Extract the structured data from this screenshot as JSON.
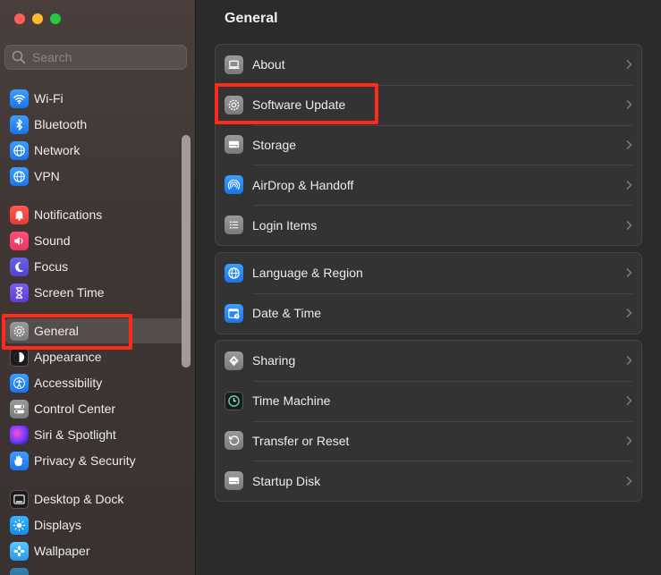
{
  "sidebar": {
    "search_placeholder": "Search",
    "items": [
      {
        "label": "Wi-Fi",
        "icon": "wifi-icon"
      },
      {
        "label": "Bluetooth",
        "icon": "bluetooth-icon"
      },
      {
        "label": "Network",
        "icon": "globe-icon"
      },
      {
        "label": "VPN",
        "icon": "globe-icon"
      },
      {
        "label": "Notifications",
        "icon": "bell-icon"
      },
      {
        "label": "Sound",
        "icon": "speaker-icon"
      },
      {
        "label": "Focus",
        "icon": "moon-icon"
      },
      {
        "label": "Screen Time",
        "icon": "hourglass-icon"
      },
      {
        "label": "General",
        "icon": "gear-icon",
        "selected": true
      },
      {
        "label": "Appearance",
        "icon": "appearance-icon"
      },
      {
        "label": "Accessibility",
        "icon": "accessibility-icon"
      },
      {
        "label": "Control Center",
        "icon": "toggles-icon"
      },
      {
        "label": "Siri & Spotlight",
        "icon": "siri-icon"
      },
      {
        "label": "Privacy & Security",
        "icon": "hand-icon"
      },
      {
        "label": "Desktop & Dock",
        "icon": "dock-icon"
      },
      {
        "label": "Displays",
        "icon": "sun-icon"
      },
      {
        "label": "Wallpaper",
        "icon": "flower-icon"
      }
    ]
  },
  "main": {
    "title": "General",
    "groups": [
      [
        {
          "label": "About",
          "icon": "laptop-icon"
        },
        {
          "label": "Software Update",
          "icon": "gear-icon"
        },
        {
          "label": "Storage",
          "icon": "drive-icon"
        },
        {
          "label": "AirDrop & Handoff",
          "icon": "airdrop-icon"
        },
        {
          "label": "Login Items",
          "icon": "list-icon"
        }
      ],
      [
        {
          "label": "Language & Region",
          "icon": "globe-icon"
        },
        {
          "label": "Date & Time",
          "icon": "calendar-clock-icon"
        }
      ],
      [
        {
          "label": "Sharing",
          "icon": "sharing-icon"
        },
        {
          "label": "Time Machine",
          "icon": "time-machine-icon"
        },
        {
          "label": "Transfer or Reset",
          "icon": "reset-icon"
        },
        {
          "label": "Startup Disk",
          "icon": "drive-icon"
        }
      ]
    ]
  },
  "colors": {
    "highlight": "#ff2a1a",
    "selection": "#5a5250",
    "background": "#2b2b2b"
  }
}
